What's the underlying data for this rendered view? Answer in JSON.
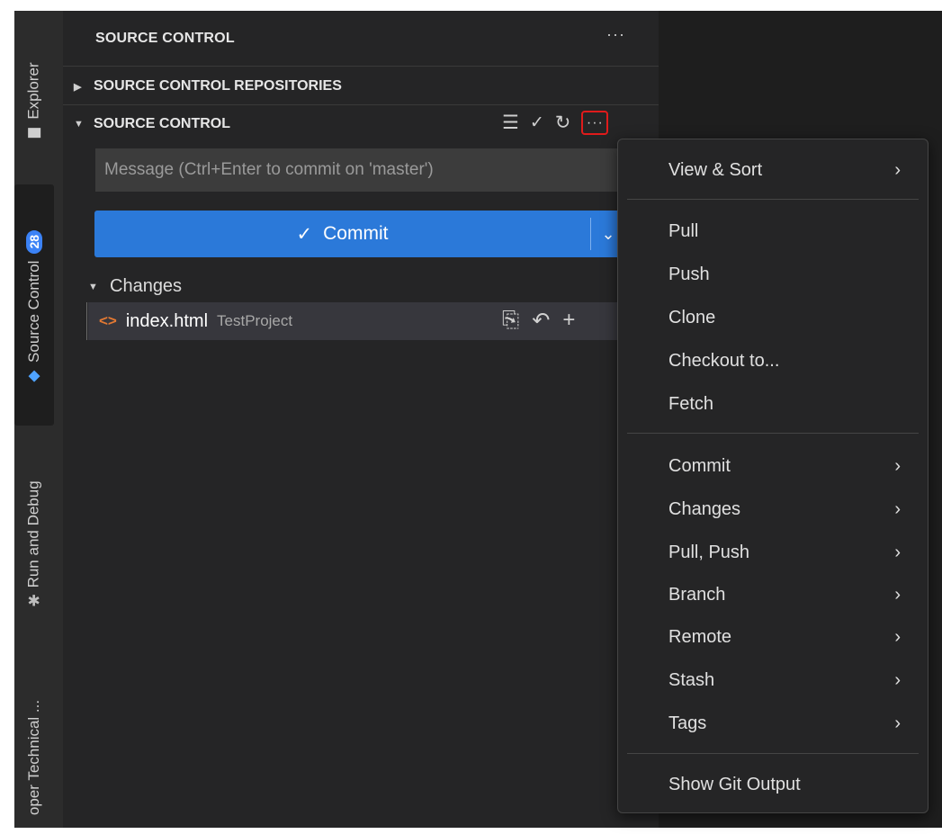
{
  "activity_bar": {
    "explorer_label": "Explorer",
    "source_control_label": "Source Control",
    "source_control_badge": "28",
    "run_debug_label": "Run and Debug",
    "extra_label": "oper Technical ..."
  },
  "sidebar": {
    "title": "SOURCE CONTROL",
    "more": "···",
    "repositories_header": "SOURCE CONTROL REPOSITORIES",
    "section_header": "SOURCE CONTROL",
    "message_placeholder": "Message (Ctrl+Enter to commit on 'master')",
    "commit_label": "Commit",
    "changes_label": "Changes",
    "file": {
      "name": "index.html",
      "path": "TestProject"
    }
  },
  "icons": {
    "list_view": "list-tree-icon",
    "commit_check": "check-icon",
    "refresh": "refresh-icon",
    "more": "ellipsis-icon",
    "open_file": "go-to-file-icon",
    "discard": "discard-icon",
    "stage": "plus-icon",
    "file_type": "html-file-icon"
  },
  "menu": {
    "items": [
      {
        "label": "View & Sort",
        "submenu": true
      },
      {
        "label": "Pull",
        "submenu": false
      },
      {
        "label": "Push",
        "submenu": false
      },
      {
        "label": "Clone",
        "submenu": false
      },
      {
        "label": "Checkout to...",
        "submenu": false
      },
      {
        "label": "Fetch",
        "submenu": false
      },
      {
        "label": "Commit",
        "submenu": true
      },
      {
        "label": "Changes",
        "submenu": true
      },
      {
        "label": "Pull, Push",
        "submenu": true
      },
      {
        "label": "Branch",
        "submenu": true
      },
      {
        "label": "Remote",
        "submenu": true
      },
      {
        "label": "Stash",
        "submenu": true
      },
      {
        "label": "Tags",
        "submenu": true
      },
      {
        "label": "Show Git Output",
        "submenu": false
      }
    ]
  },
  "colors": {
    "accent": "#2b79d9",
    "highlight_border": "#e01b1b",
    "badge": "#3b82f6"
  }
}
